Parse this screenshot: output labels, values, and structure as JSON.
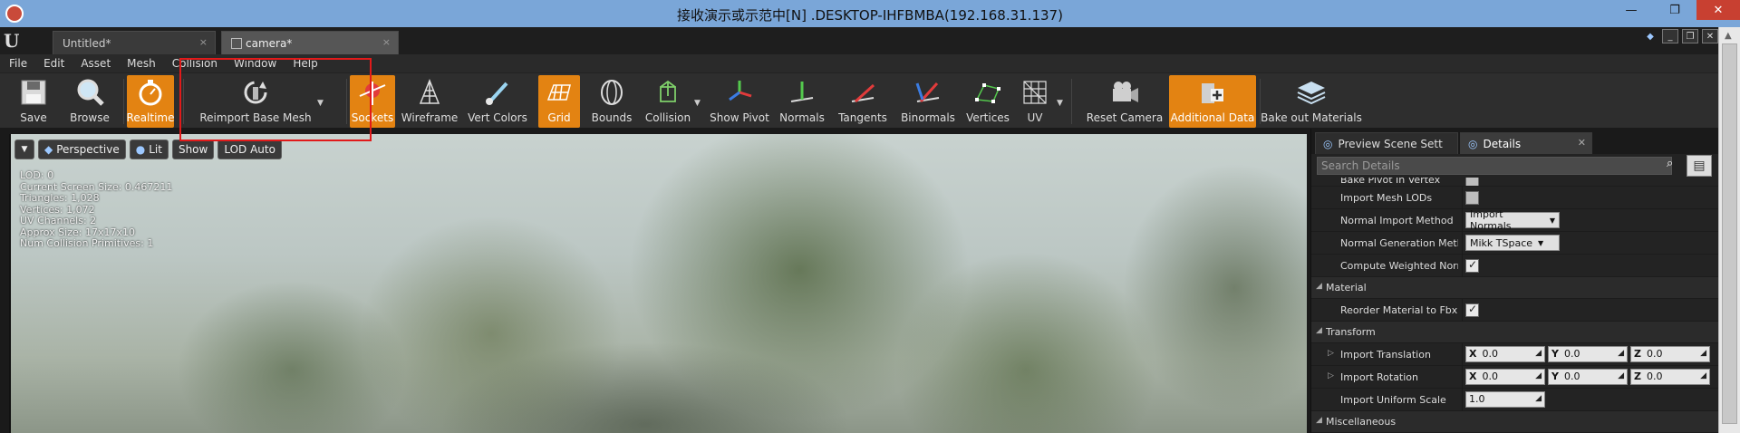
{
  "rdp": {
    "title": "接收演示或示范中[N] .DESKTOP-IHFBMBA(192.168.31.137)",
    "min_label": "—",
    "max_label": "❐",
    "close_label": "✕"
  },
  "editor": {
    "tabs": [
      {
        "label": "Untitled*",
        "close": "×"
      },
      {
        "label": "camera*",
        "close": "×"
      }
    ]
  },
  "menu": [
    "File",
    "Edit",
    "Asset",
    "Mesh",
    "Collision",
    "Window",
    "Help"
  ],
  "toolbar": {
    "save": "Save",
    "browse": "Browse",
    "realtime": "Realtime",
    "reimport": "Reimport Base Mesh",
    "sockets": "Sockets",
    "wireframe": "Wireframe",
    "vert_colors": "Vert Colors",
    "grid": "Grid",
    "bounds": "Bounds",
    "collision": "Collision",
    "show_pivot": "Show Pivot",
    "normals": "Normals",
    "tangents": "Tangents",
    "binormals": "Binormals",
    "vertices": "Vertices",
    "uv": "UV",
    "reset_camera": "Reset Camera",
    "additional_data": "Additional Data",
    "bake_materials": "Bake out Materials"
  },
  "viewport": {
    "perspective": "Perspective",
    "lit": "Lit",
    "show": "Show",
    "lod": "LOD Auto",
    "stats": [
      "LOD:  0",
      "Current Screen Size:  0.467211",
      "Triangles:  1,028",
      "Vertices:  1,072",
      "UV Channels:  2",
      "Approx Size: 17x17x10",
      "Num Collision Primitives:  1"
    ]
  },
  "details": {
    "tab_preview": "Preview Scene Sett",
    "tab_details": "Details",
    "search_placeholder": "Search Details",
    "cut_row": "Bake Pivot In Vertex",
    "import_mesh_lods": "Import Mesh LODs",
    "normal_import_method": "Normal Import Method",
    "normal_import_value": "Import Normals",
    "normal_generation_method": "Normal Generation Method",
    "normal_generation_value": "Mikk TSpace",
    "compute_weighted": "Compute Weighted Normals",
    "cat_material": "Material",
    "reorder_material": "Reorder Material to Fbx Order",
    "cat_transform": "Transform",
    "import_translation": "Import Translation",
    "import_rotation": "Import Rotation",
    "import_uniform_scale": "Import Uniform Scale",
    "cat_misc": "Miscellaneous",
    "x": "X",
    "y": "Y",
    "z": "Z",
    "zero": "0.0",
    "scale_value": "1.0"
  }
}
